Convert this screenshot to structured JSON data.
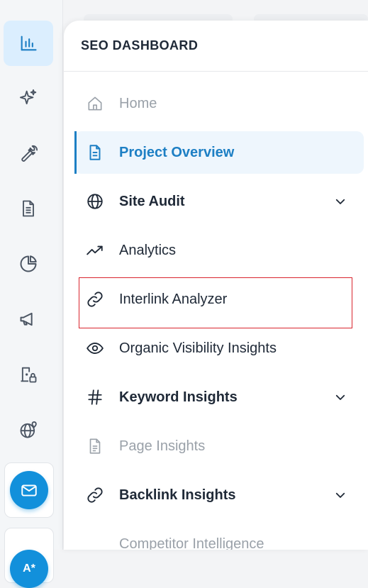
{
  "rail": {
    "items": [
      {
        "icon": "bar-chart-icon",
        "active": true
      },
      {
        "icon": "sparkles-icon",
        "active": false
      },
      {
        "icon": "wrench-icon",
        "active": false
      },
      {
        "icon": "document-icon",
        "active": false
      },
      {
        "icon": "pie-chart-icon",
        "active": false
      },
      {
        "icon": "megaphone-icon",
        "active": false
      },
      {
        "icon": "user-lock-icon",
        "active": false
      },
      {
        "icon": "globe-pin-icon",
        "active": false
      }
    ],
    "mail_button": {
      "icon": "mail-icon"
    },
    "ai_button": {
      "label": "A*"
    }
  },
  "panel": {
    "title": "SEO DASHBOARD",
    "nav": [
      {
        "label": "Home",
        "icon": "home-icon",
        "state": "muted"
      },
      {
        "label": "Project Overview",
        "icon": "document-icon",
        "state": "active"
      },
      {
        "label": "Site Audit",
        "icon": "globe-icon",
        "state": "bold",
        "expandable": true
      },
      {
        "label": "Analytics",
        "icon": "trending-up-icon",
        "state": "normal",
        "highlighted": true
      },
      {
        "label": "Interlink Analyzer",
        "icon": "link-icon",
        "state": "normal"
      },
      {
        "label": "Organic Visibility Insights",
        "icon": "eye-icon",
        "state": "normal"
      },
      {
        "label": "Keyword Insights",
        "icon": "hash-icon",
        "state": "bold",
        "expandable": true
      },
      {
        "label": "Page Insights",
        "icon": "page-icon",
        "state": "muted"
      },
      {
        "label": "Backlink Insights",
        "icon": "link-icon",
        "state": "bold",
        "expandable": true
      },
      {
        "label": "Competitor Intelligence",
        "icon": "competitor-icon",
        "state": "muted"
      }
    ]
  },
  "colors": {
    "accent": "#1d7fc4",
    "active_bg": "#eef6fd",
    "highlight_border": "#d9252e"
  }
}
